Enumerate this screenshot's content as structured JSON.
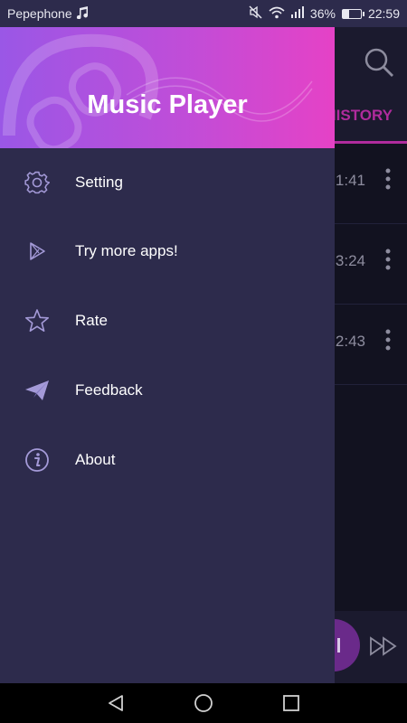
{
  "status": {
    "carrier": "Pepephone",
    "battery": "36%",
    "battery_level": 0.36,
    "time": "22:59"
  },
  "background": {
    "tab_label": "HISTORY",
    "durations": [
      "1:41",
      "3:24",
      "2:43"
    ]
  },
  "drawer": {
    "title": "Music Player",
    "items": [
      {
        "label": "Setting",
        "icon": "gear-icon"
      },
      {
        "label": "Try more apps!",
        "icon": "play-store-icon"
      },
      {
        "label": "Rate",
        "icon": "star-icon"
      },
      {
        "label": "Feedback",
        "icon": "paper-plane-icon"
      },
      {
        "label": "About",
        "icon": "info-icon"
      }
    ]
  },
  "colors": {
    "drawer_bg": "#2d2b4c",
    "header_gradient_start": "#9a57e6",
    "header_gradient_end": "#e542c6",
    "icon_color": "#a49ad8",
    "accent": "#b02b9d"
  }
}
